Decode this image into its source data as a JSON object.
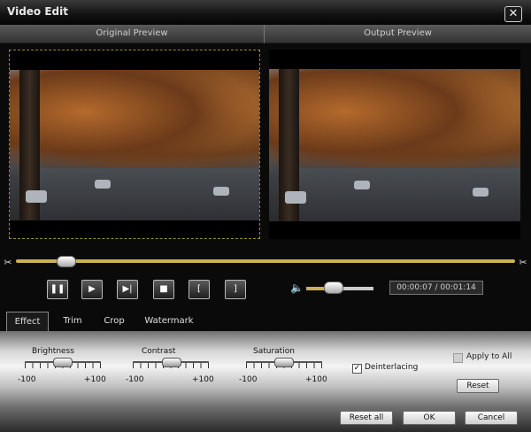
{
  "window": {
    "title": "Video Edit",
    "close_icon": "close-icon"
  },
  "preview_headers": {
    "original": "Original Preview",
    "output": "Output Preview"
  },
  "playback": {
    "seek_position": 0.085,
    "volume_level": 0.4,
    "time_display": "00:00:07 / 00:01:14",
    "buttons": [
      "pause-icon",
      "play-icon",
      "next-frame-icon",
      "stop-icon",
      "mark-in-icon",
      "mark-out-icon"
    ]
  },
  "tabs": [
    "Effect",
    "Trim",
    "Crop",
    "Watermark"
  ],
  "active_tab": "Effect",
  "effect": {
    "sliders": [
      {
        "label": "Brightness",
        "min": "-100",
        "max": "+100",
        "value": 0
      },
      {
        "label": "Contrast",
        "min": "-100",
        "max": "+100",
        "value": 0
      },
      {
        "label": "Saturation",
        "min": "-100",
        "max": "+100",
        "value": 0
      }
    ],
    "deinterlacing": {
      "label": "Deinterlacing",
      "checked": true
    },
    "apply_to_all": {
      "label": "Apply to All",
      "checked": false
    },
    "reset_label": "Reset"
  },
  "footer": {
    "reset_all_label": "Reset all",
    "ok_label": "OK",
    "cancel_label": "Cancel"
  },
  "colors": {
    "accent": "#c9b255",
    "titlebar": "#111111"
  }
}
